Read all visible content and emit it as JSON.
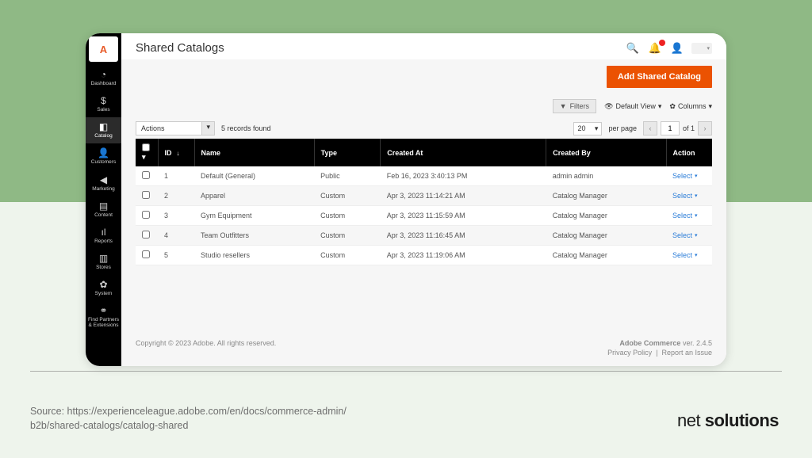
{
  "page": {
    "title": "Shared Catalogs"
  },
  "sidebar": {
    "items": [
      {
        "icon": "◔",
        "label": "Dashboard"
      },
      {
        "icon": "$",
        "label": "Sales"
      },
      {
        "icon": "◧",
        "label": "Catalog"
      },
      {
        "icon": "👤",
        "label": "Customers"
      },
      {
        "icon": "◀",
        "label": "Marketing"
      },
      {
        "icon": "▤",
        "label": "Content"
      },
      {
        "icon": "ıl",
        "label": "Reports"
      },
      {
        "icon": "▥",
        "label": "Stores"
      },
      {
        "icon": "✿",
        "label": "System"
      },
      {
        "icon": "⚭",
        "label": "Find Partners & Extensions"
      }
    ],
    "active_index": 2
  },
  "header": {
    "primary_action": "Add Shared Catalog"
  },
  "toolbar": {
    "filters": "Filters",
    "default_view": "Default View",
    "columns": "Columns"
  },
  "grid": {
    "actions_label": "Actions",
    "records_found": "5 records found",
    "per_page_value": "20",
    "per_page_label": "per page",
    "page_value": "1",
    "of_pages": "of 1",
    "columns": [
      "ID",
      "Name",
      "Type",
      "Created At",
      "Created By",
      "Action"
    ],
    "select_label": "Select",
    "rows": [
      {
        "id": "1",
        "name": "Default (General)",
        "type": "Public",
        "created_at": "Feb 16, 2023 3:40:13 PM",
        "created_by": "admin admin"
      },
      {
        "id": "2",
        "name": "Apparel",
        "type": "Custom",
        "created_at": "Apr 3, 2023 11:14:21 AM",
        "created_by": "Catalog Manager"
      },
      {
        "id": "3",
        "name": "Gym Equipment",
        "type": "Custom",
        "created_at": "Apr 3, 2023 11:15:59 AM",
        "created_by": "Catalog Manager"
      },
      {
        "id": "4",
        "name": "Team Outfitters",
        "type": "Custom",
        "created_at": "Apr 3, 2023 11:16:45 AM",
        "created_by": "Catalog Manager"
      },
      {
        "id": "5",
        "name": "Studio resellers",
        "type": "Custom",
        "created_at": "Apr 3, 2023 11:19:06 AM",
        "created_by": "Catalog Manager"
      }
    ]
  },
  "footer": {
    "copyright": "Copyright © 2023 Adobe. All rights reserved.",
    "product": "Adobe Commerce",
    "version": "ver. 2.4.5",
    "privacy": "Privacy Policy",
    "report": "Report an Issue"
  },
  "caption": {
    "source": "Source: https://experienceleague.adobe.com/en/docs/commerce-admin/\nb2b/shared-catalogs/catalog-shared",
    "brand_light": "net ",
    "brand_bold": "solutions"
  }
}
